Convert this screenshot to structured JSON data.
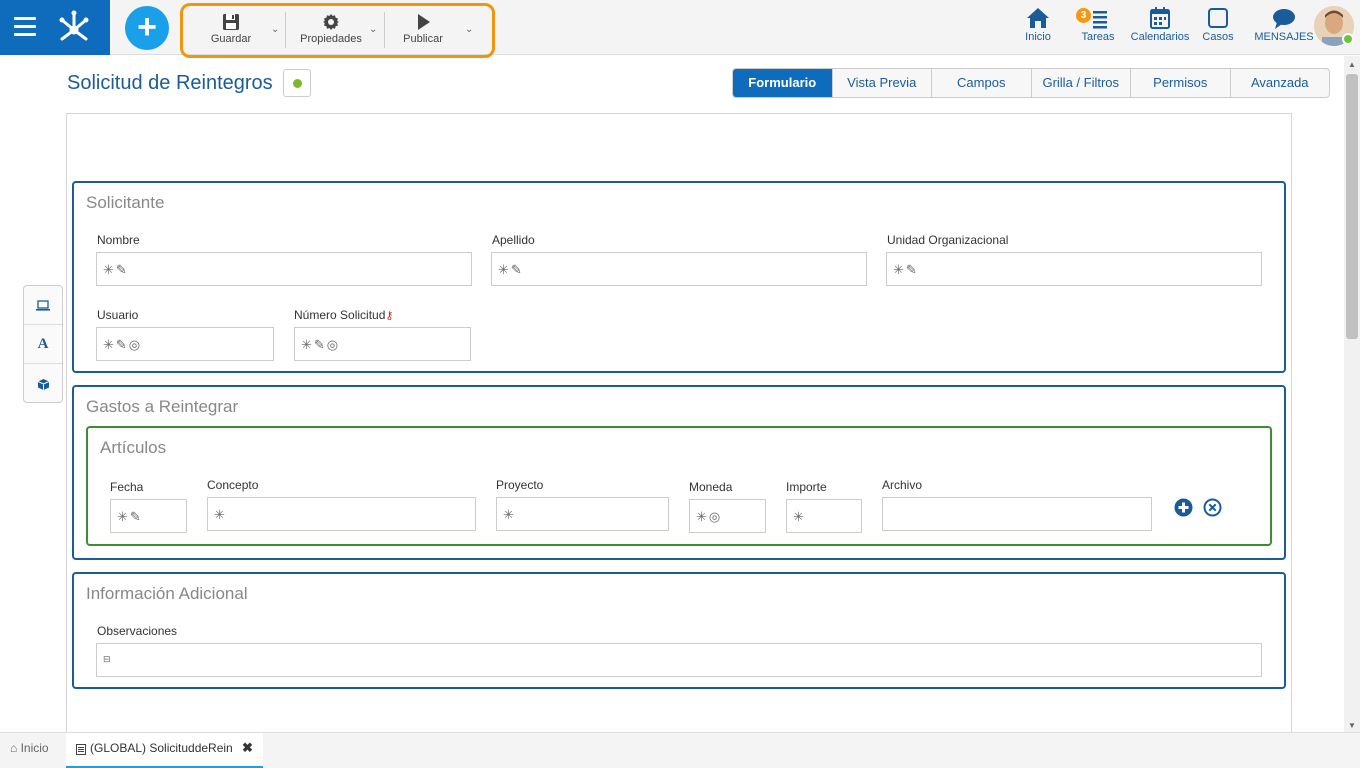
{
  "toolbar": {
    "save_label": "Guardar",
    "properties_label": "Propiedades",
    "publish_label": "Publicar"
  },
  "nav": {
    "home_label": "Inicio",
    "tasks_label": "Tareas",
    "tasks_count": "3",
    "calendars_label": "Calendarios",
    "cases_label": "Casos",
    "messages_label": "MENSAJES"
  },
  "page": {
    "title": "Solicitud de Reintegros"
  },
  "tabs": [
    "Formulario",
    "Vista Previa",
    "Campos",
    "Grilla / Filtros",
    "Permisos",
    "Avanzada"
  ],
  "sections": {
    "solicitante": {
      "title": "Solicitante",
      "fields": {
        "nombre": "Nombre",
        "apellido": "Apellido",
        "unidad": "Unidad Organizacional",
        "usuario": "Usuario",
        "numero": "Número Solicitud"
      }
    },
    "gastos": {
      "title": "Gastos a Reintegrar",
      "articulos": {
        "title": "Artículos",
        "columns": {
          "fecha": "Fecha",
          "concepto": "Concepto",
          "proyecto": "Proyecto",
          "moneda": "Moneda",
          "importe": "Importe",
          "archivo": "Archivo"
        }
      }
    },
    "info": {
      "title": "Información Adicional",
      "fields": {
        "observaciones": "Observaciones"
      }
    }
  },
  "bottom": {
    "home_label": "Inicio",
    "doc_tab_label": "(GLOBAL) SolicituddeRein"
  },
  "colors": {
    "brand_blue": "#0f6cbd",
    "accent_orange": "#f0950e",
    "section_border": "#1a5c99",
    "subsection_border": "#3e8e2f",
    "status_green": "#7db82e"
  }
}
